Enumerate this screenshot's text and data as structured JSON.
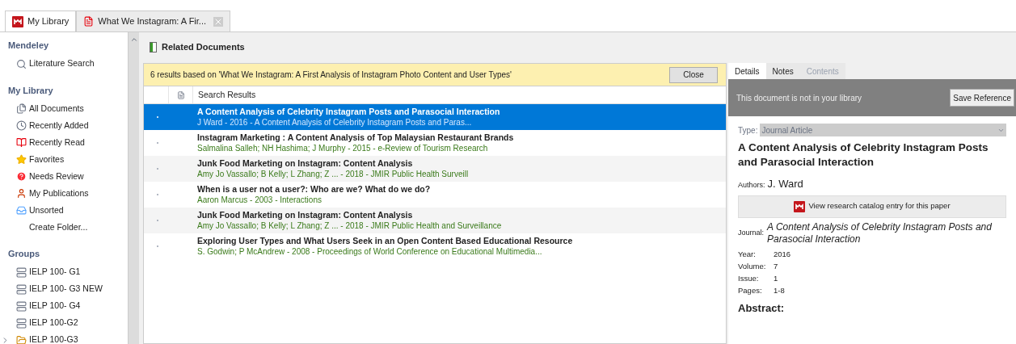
{
  "tabs": [
    {
      "label": "My Library",
      "selected": true,
      "kind": "library"
    },
    {
      "label": "What We Instagram: A Fir...",
      "selected": false,
      "kind": "pdf"
    }
  ],
  "sidebar": {
    "sections": [
      {
        "heading": "Mendeley",
        "items": [
          {
            "label": "Literature Search",
            "kind": "search"
          }
        ]
      },
      {
        "heading": "My Library",
        "items": [
          {
            "label": "All Documents",
            "kind": "documents"
          },
          {
            "label": "Recently Added",
            "kind": "clock"
          },
          {
            "label": "Recently Read",
            "kind": "book"
          },
          {
            "label": "Favorites",
            "kind": "star"
          },
          {
            "label": "Needs Review",
            "kind": "review"
          },
          {
            "label": "My Publications",
            "kind": "person"
          },
          {
            "label": "Unsorted",
            "kind": "inbox"
          },
          {
            "label": "Create Folder...",
            "kind": "action"
          }
        ]
      },
      {
        "heading": "Groups",
        "items": [
          {
            "label": "IELP 100- G1",
            "kind": "group"
          },
          {
            "label": "IELP 100- G3 NEW",
            "kind": "group"
          },
          {
            "label": "IELP 100- G4",
            "kind": "group"
          },
          {
            "label": "IELP 100-G2",
            "kind": "group"
          },
          {
            "label": "IELP 100-G3",
            "kind": "shared"
          }
        ]
      }
    ]
  },
  "panel": {
    "title": "Related Documents",
    "banner": {
      "text": "6 results based on 'What We Instagram: A First Analysis of Instagram Photo Content and User Types'",
      "button": "Close"
    },
    "column": "Search Results",
    "rows": [
      {
        "title": "A Content Analysis of Celebrity Instagram Posts and Parasocial Interaction",
        "meta": "J Ward - 2016 - A Content Analysis of Celebrity Instagram Posts and Paras...",
        "selected": true
      },
      {
        "title": "Instagram Marketing : A Content Analysis of Top Malaysian Restaurant Brands",
        "meta": "Salmalina Salleh; NH Hashima; J Murphy - 2015 - e-Review of Tourism Research",
        "selected": false
      },
      {
        "title": "Junk Food Marketing on Instagram: Content Analysis",
        "meta": "Amy Jo Vassallo; B Kelly; L Zhang; Z ... - 2018 - JMIR Public Health Surveill",
        "selected": false
      },
      {
        "title": "When is a user not a user?: Who are we? What do we do?",
        "meta": "Aaron Marcus - 2003 - Interactions",
        "selected": false
      },
      {
        "title": "Junk Food Marketing on Instagram: Content Analysis",
        "meta": "Amy Jo Vassallo; B Kelly; L Zhang; Z ... - 2018 - JMIR Public Health and Surveillance",
        "selected": false
      },
      {
        "title": "Exploring User Types and What Users Seek in an Open Content Based Educational Resource",
        "meta": "S. Godwin; P McAndrew - 2008 - Proceedings of World Conference on Educational Multimedia...",
        "selected": false
      }
    ]
  },
  "details": {
    "tabs": [
      {
        "label": "Details",
        "selected": true,
        "disabled": false
      },
      {
        "label": "Notes",
        "selected": false,
        "disabled": false
      },
      {
        "label": "Contents",
        "selected": false,
        "disabled": true
      }
    ],
    "notice": {
      "text": "This document is not in your library",
      "button": "Save Reference"
    },
    "type_label": "Type:",
    "type_value": "Journal Article",
    "title": "A Content Analysis of Celebrity Instagram Posts and Parasocial Interaction",
    "authors_label": "Authors:",
    "authors": "J. Ward",
    "catalog_button": "View research catalog entry for this paper",
    "journal_label": "Journal:",
    "journal": "A Content Analysis of Celebrity Instagram Posts and Parasocial Interaction",
    "fields": [
      {
        "label": "Year:",
        "value": "2016"
      },
      {
        "label": "Volume:",
        "value": "7"
      },
      {
        "label": "Issue:",
        "value": "1"
      },
      {
        "label": "Pages:",
        "value": "1-8"
      }
    ],
    "abstract_heading": "Abstract:"
  }
}
